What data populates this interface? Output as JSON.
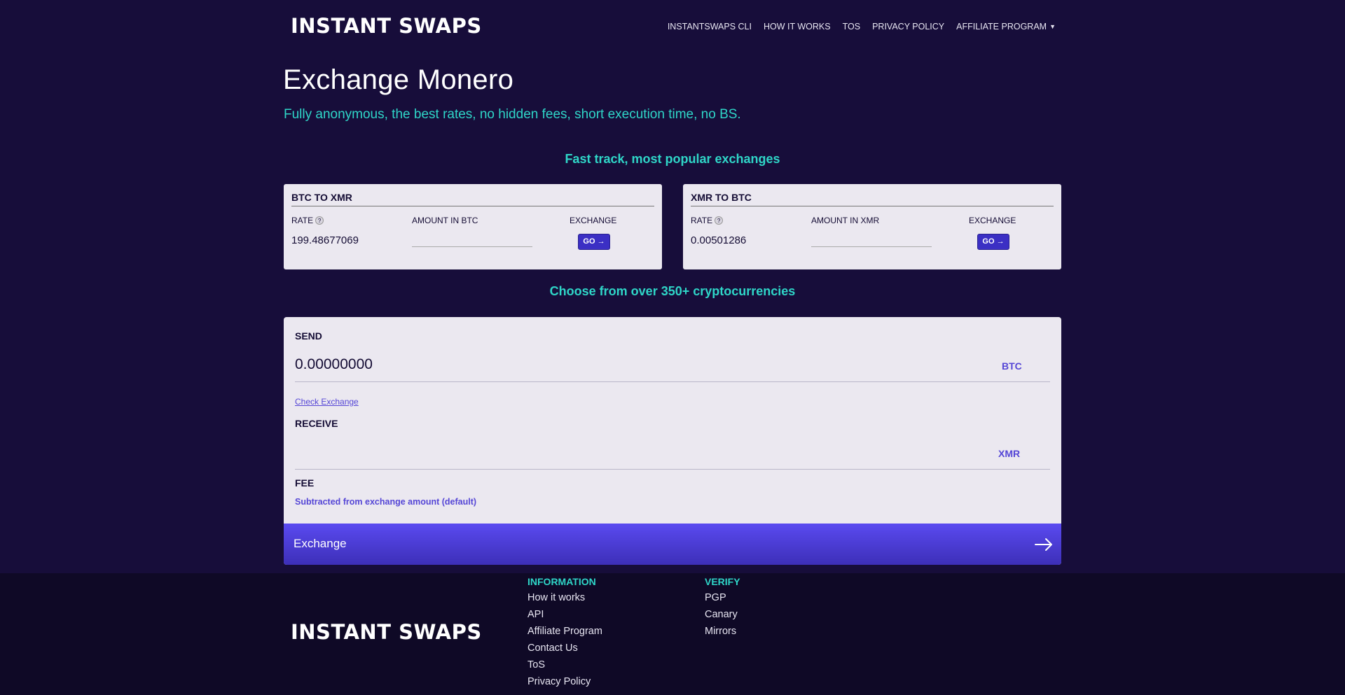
{
  "header": {
    "logo": "INSTANT SWAPS",
    "nav": [
      "INSTANTSWAPS CLI",
      "HOW IT WORKS",
      "TOS",
      "PRIVACY POLICY",
      "AFFILIATE PROGRAM"
    ]
  },
  "hero": {
    "title": "Exchange Monero",
    "subtitle": "Fully anonymous, the best rates, no hidden fees, short execution time, no BS."
  },
  "fast_track": {
    "title": "Fast track, most popular exchanges",
    "cards": [
      {
        "title": "BTC TO XMR",
        "rate_label": "RATE",
        "amount_label": "AMOUNT IN BTC",
        "exchange_label": "EXCHANGE",
        "rate": "199.48677069",
        "go": "GO →"
      },
      {
        "title": "XMR TO BTC",
        "rate_label": "RATE",
        "amount_label": "AMOUNT IN XMR",
        "exchange_label": "EXCHANGE",
        "rate": "0.00501286",
        "go": "GO →"
      }
    ]
  },
  "choose": {
    "title": "Choose from over 350+ cryptocurrencies"
  },
  "exchange_form": {
    "send_label": "SEND",
    "send_value": "0.00000000",
    "send_currency": "BTC",
    "check_link": "Check Exchange",
    "receive_label": "RECEIVE",
    "receive_value": "",
    "receive_currency": "XMR",
    "fee_label": "FEE",
    "fee_note": "Subtracted from exchange amount (default)",
    "submit": "Exchange"
  },
  "footer": {
    "logo": "INSTANT SWAPS",
    "information_title": "INFORMATION",
    "information": [
      "How it works",
      "API",
      "Affiliate Program",
      "Contact Us",
      "ToS",
      "Privacy Policy"
    ],
    "verify_title": "VERIFY",
    "verify": [
      "PGP",
      "Canary",
      "Mirrors"
    ]
  },
  "colors": {
    "background": "#170d3a",
    "accent_teal": "#2fd6c8",
    "accent_purple": "#5546d6",
    "card_bg": "#ebe8f0"
  }
}
